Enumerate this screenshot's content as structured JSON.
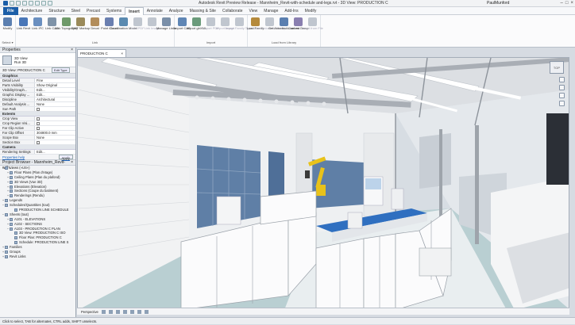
{
  "app": {
    "title": "Autodesk Revit Preview Release - Mannheim_Revit-with-schedule and-legs.rvt - 3D View: PRODUCTION C",
    "user": "PaulMunford"
  },
  "menu": {
    "file": "File",
    "tabs": [
      "Architecture",
      "Structure",
      "Steel",
      "Precast",
      "Systems",
      "Insert",
      "Annotate",
      "Analyze",
      "Massing & Site",
      "Collaborate",
      "View",
      "Manage",
      "Add-Ins",
      "Modify"
    ],
    "active": "Insert"
  },
  "ribbon": {
    "groups": [
      {
        "name": "Select ▾",
        "buttons": [
          {
            "label": "Modify",
            "color": "#5b7fb0"
          }
        ]
      },
      {
        "name": "Link",
        "buttons": [
          {
            "label": "Link Revit",
            "color": "#4a77b8"
          },
          {
            "label": "Link IFC",
            "color": "#6a8fc0"
          },
          {
            "label": "Link CAD",
            "color": "#7f93a8"
          },
          {
            "label": "Link Topography",
            "color": "#6f9a6a"
          },
          {
            "label": "DWF Markup",
            "color": "#9a8a5a"
          },
          {
            "label": "Decal",
            "color": "#b28d5c"
          },
          {
            "label": "Point Cloud",
            "color": "#6a7fb0"
          },
          {
            "label": "Coordination Model",
            "color": "#5a8ab0"
          },
          {
            "label": "Link PDF",
            "color": "#c0c6cf",
            "dim": true
          },
          {
            "label": "Link Image",
            "color": "#c0c6cf",
            "dim": true
          },
          {
            "label": "Manage Links",
            "color": "#7a8fa8"
          }
        ]
      },
      {
        "name": "Import",
        "buttons": [
          {
            "label": "Import CAD",
            "color": "#5f86b5"
          },
          {
            "label": "Import gbXML",
            "color": "#6b9b7b"
          },
          {
            "label": "Import PDF",
            "color": "#c0c6cf",
            "dim": true
          },
          {
            "label": "Import Image",
            "color": "#c0c6cf",
            "dim": true
          },
          {
            "label": "Import Family Types",
            "color": "#c0c6cf",
            "dim": true
          }
        ]
      },
      {
        "name": "Load from Library",
        "buttons": [
          {
            "label": "Load Family",
            "color": "#b58a3c"
          },
          {
            "label": "Load Autodesk Family",
            "color": "#c0c6cf",
            "dim": true
          },
          {
            "label": "Get Autodesk Content",
            "color": "#5a7fb0"
          },
          {
            "label": "Load as Group",
            "color": "#8a7fb0"
          },
          {
            "label": "Insert from File",
            "color": "#c0c6cf",
            "dim": true
          }
        ]
      }
    ]
  },
  "properties": {
    "header": "Properties",
    "type_name": "3D View",
    "type_sub": "Run 3D",
    "selector": "3D View: PRODUCTION C",
    "edit_type": "Edit Type",
    "sections": [
      {
        "name": "Graphics",
        "rows": [
          {
            "name": "Detail Level",
            "value": "Fine"
          },
          {
            "name": "Parts Visibility",
            "value": "Show Original"
          },
          {
            "name": "Visibility/Graph...",
            "value": "Edit..."
          },
          {
            "name": "Graphic Display ...",
            "value": "Edit..."
          },
          {
            "name": "Discipline",
            "value": "Architectural"
          },
          {
            "name": "Default Analysis ...",
            "value": "None"
          },
          {
            "name": "Sun Path",
            "value": "",
            "check": true
          }
        ]
      },
      {
        "name": "Extents",
        "rows": [
          {
            "name": "Crop View",
            "value": "",
            "check": true
          },
          {
            "name": "Crop Region Visi...",
            "value": "",
            "check": true
          },
          {
            "name": "Far Clip Active",
            "value": "",
            "check": true
          },
          {
            "name": "Far Clip Offset",
            "value": "304800.0 mm"
          },
          {
            "name": "Scope Box",
            "value": "None"
          },
          {
            "name": "Section Box",
            "value": "",
            "check": true
          }
        ]
      },
      {
        "name": "Camera",
        "rows": [
          {
            "name": "Rendering Settings",
            "value": "Edit..."
          }
        ]
      }
    ],
    "help": "Properties help",
    "apply": "Apply"
  },
  "browser": {
    "header": "Project Browser - Mannheim_Revit-with...",
    "rows": [
      {
        "text": "Views (»US«)",
        "level": 0,
        "tw": "−"
      },
      {
        "text": "Floor Plans (Plan d'etage)",
        "level": 1,
        "tw": "+"
      },
      {
        "text": "Ceiling Plans (Plan du plafond)",
        "level": 1,
        "tw": "+"
      },
      {
        "text": "3D Views (Vue 3D)",
        "level": 1,
        "tw": "+"
      },
      {
        "text": "Elevations (Elevation)",
        "level": 1,
        "tw": "+"
      },
      {
        "text": "Sections (Coupe du batiment)",
        "level": 1,
        "tw": "+"
      },
      {
        "text": "Renderings (Rendu)",
        "level": 1,
        "tw": "+"
      },
      {
        "text": "Legends",
        "level": 0,
        "tw": "+"
      },
      {
        "text": "Schedules/Quantities (tout)",
        "level": 0,
        "tw": "−"
      },
      {
        "text": "PRODUCTION LINE SCHEDULE",
        "level": 2,
        "tw": ""
      },
      {
        "text": "Sheets (tout)",
        "level": 0,
        "tw": "−"
      },
      {
        "text": "A101 - ELEVATIONS",
        "level": 1,
        "tw": "+"
      },
      {
        "text": "A102 - SECTIONS",
        "level": 1,
        "tw": "+"
      },
      {
        "text": "A103 - PRODUCTION C PLAN",
        "level": 1,
        "tw": "−"
      },
      {
        "text": "3D View: PRODUCTION C ISO",
        "level": 2,
        "tw": ""
      },
      {
        "text": "Floor Plan: PRODUCTION C",
        "level": 2,
        "tw": ""
      },
      {
        "text": "Schedule: PRODUCTION LINE S",
        "level": 2,
        "tw": ""
      },
      {
        "text": "Families",
        "level": 0,
        "tw": "+"
      },
      {
        "text": "Groups",
        "level": 0,
        "tw": "+"
      },
      {
        "text": "Revit Links",
        "level": 0,
        "tw": "+"
      }
    ]
  },
  "view": {
    "tab": "PRODUCTION C",
    "tab_close": "×",
    "mode": "Perspective",
    "cube": "TOP"
  },
  "status": {
    "text": "Click to select, TAB for alternates, CTRL adds, SHIFT unselects."
  },
  "colors": {
    "ribbon_bg": "#fbfbfc",
    "file_tab": "#1b5ea8",
    "wall_white": "#f4f5f6",
    "steel": "#c9ccd0",
    "window_blue": "#5f7fa6",
    "floor": "#a8c4c8",
    "robot_yellow": "#e8c21a",
    "conveyor_blue": "#2f6fc0"
  }
}
